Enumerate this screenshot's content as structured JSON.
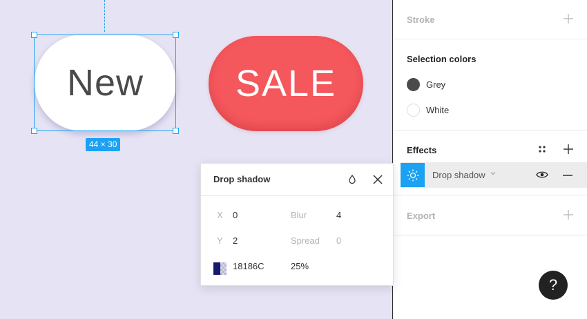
{
  "canvas": {
    "new_label": "New",
    "sale_label": "SALE",
    "size_badge": "44 × 30"
  },
  "popup": {
    "title": "Drop shadow",
    "x_label": "X",
    "x_value": "0",
    "y_label": "Y",
    "y_value": "2",
    "blur_label": "Blur",
    "blur_value": "4",
    "spread_label": "Spread",
    "spread_value": "0",
    "color_value": "18186C",
    "opacity_value": "25%",
    "swatch_color": "#18186C"
  },
  "panel": {
    "stroke_title": "Stroke",
    "selection_colors_title": "Selection colors",
    "colors": [
      {
        "label": "Grey",
        "color": "#4a4a4a"
      },
      {
        "label": "White",
        "color": "#ffffff"
      }
    ],
    "effects_title": "Effects",
    "effect_item_label": "Drop shadow",
    "export_title": "Export"
  },
  "help_label": "?",
  "accent_color": "#1da1f2",
  "sale_color": "#f4575c"
}
